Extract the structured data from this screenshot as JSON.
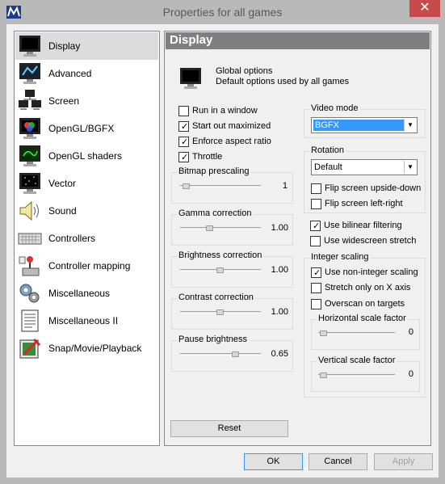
{
  "window": {
    "title": "Properties for all games",
    "close_symbol": "✕"
  },
  "sidebar": {
    "items": [
      {
        "label": "Display",
        "icon": "monitor-icon"
      },
      {
        "label": "Advanced",
        "icon": "advanced-display-icon"
      },
      {
        "label": "Screen",
        "icon": "screens-icon"
      },
      {
        "label": "OpenGL/BGFX",
        "icon": "opengl-monitor-icon"
      },
      {
        "label": "OpenGL shaders",
        "icon": "shader-monitor-icon"
      },
      {
        "label": "Vector",
        "icon": "vector-monitor-icon"
      },
      {
        "label": "Sound",
        "icon": "speaker-icon"
      },
      {
        "label": "Controllers",
        "icon": "keyboard-icon"
      },
      {
        "label": "Controller mapping",
        "icon": "joystick-icon"
      },
      {
        "label": "Miscellaneous",
        "icon": "gears-icon"
      },
      {
        "label": "Miscellaneous II",
        "icon": "document-icon"
      },
      {
        "label": "Snap/Movie/Playback",
        "icon": "snapshot-icon"
      }
    ],
    "selected": "Display"
  },
  "panel": {
    "header": "Display",
    "global_title": "Global options",
    "global_desc": "Default options used by all games",
    "checkboxes": {
      "run_in_window": {
        "label": "Run in a window",
        "checked": false
      },
      "start_maximized": {
        "label": "Start out maximized",
        "checked": true
      },
      "enforce_aspect": {
        "label": "Enforce aspect ratio",
        "checked": true
      },
      "throttle": {
        "label": "Throttle",
        "checked": true
      }
    },
    "sliders": {
      "bitmap_prescaling": {
        "label": "Bitmap prescaling",
        "value": "1",
        "level": 0.0
      },
      "gamma": {
        "label": "Gamma correction",
        "value": "1.00",
        "level": 0.5
      },
      "brightness": {
        "label": "Brightness correction",
        "value": "1.00",
        "level": 0.5
      },
      "contrast": {
        "label": "Contrast correction",
        "value": "1.00",
        "level": 0.5
      },
      "pause_brightness": {
        "label": "Pause brightness",
        "value": "0.65",
        "level": 0.65
      }
    },
    "video_mode": {
      "label": "Video mode",
      "value": "BGFX"
    },
    "rotation": {
      "label": "Rotation",
      "value": "Default",
      "flip_ud": {
        "label": "Flip screen upside-down",
        "checked": false
      },
      "flip_lr": {
        "label": "Flip screen left-right",
        "checked": false
      }
    },
    "bilinear": {
      "label": "Use bilinear filtering",
      "checked": true
    },
    "widescreen": {
      "label": "Use widescreen stretch",
      "checked": false
    },
    "integer_scaling": {
      "label": "Integer scaling",
      "non_integer": {
        "label": "Use non-integer scaling",
        "checked": true
      },
      "stretch_x": {
        "label": "Stretch only on X axis",
        "checked": false
      },
      "overscan": {
        "label": "Overscan on targets",
        "checked": false
      },
      "h_factor": {
        "label": "Horizontal scale factor",
        "value": "0",
        "level": 0.0
      },
      "v_factor": {
        "label": "Vertical scale factor",
        "value": "0",
        "level": 0.0
      }
    },
    "reset_label": "Reset"
  },
  "footer": {
    "ok": "OK",
    "cancel": "Cancel",
    "apply": "Apply"
  }
}
